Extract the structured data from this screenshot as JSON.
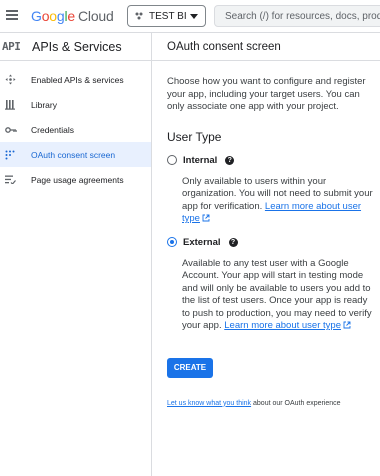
{
  "header": {
    "menu_icon": "menu-icon",
    "logo": {
      "g1": "G",
      "g2": "o",
      "g3": "o",
      "g4": "g",
      "g5": "l",
      "g6": "e",
      "cloud": "Cloud"
    },
    "project": "TEST BI",
    "search_placeholder": "Search (/) for resources, docs, products"
  },
  "sidebar": {
    "icon_text": "API",
    "title": "APIs & Services",
    "items": [
      {
        "label": "Enabled APIs & services",
        "icon": "enabled-apis-icon",
        "active": false
      },
      {
        "label": "Library",
        "icon": "library-icon",
        "active": false
      },
      {
        "label": "Credentials",
        "icon": "key-icon",
        "active": false
      },
      {
        "label": "OAuth consent screen",
        "icon": "oauth-consent-icon",
        "active": true
      },
      {
        "label": "Page usage agreements",
        "icon": "page-usage-icon",
        "active": false
      }
    ]
  },
  "main": {
    "title": "OAuth consent screen",
    "intro": "Choose how you want to configure and register your app, including your target users. You can only associate one app with your project.",
    "user_type_title": "User Type",
    "internal": {
      "label": "Internal",
      "selected": false,
      "desc": "Only available to users within your organization. You will not need to submit your app for verification.",
      "link": "Learn more about user type"
    },
    "external": {
      "label": "External",
      "selected": true,
      "desc": "Available to any test user with a Google Account. Your app will start in testing mode and will only be available to users you add to the list of test users. Once your app is ready to push to production, you may need to verify your app.",
      "link": "Learn more about user type"
    },
    "create_label": "CREATE",
    "feedback_link": "Let us know what you think",
    "feedback_text": "about our OAuth experience"
  },
  "colors": {
    "accent": "#1a73e8",
    "active_bg": "#e8f0fe",
    "active_text": "#1967d2"
  }
}
